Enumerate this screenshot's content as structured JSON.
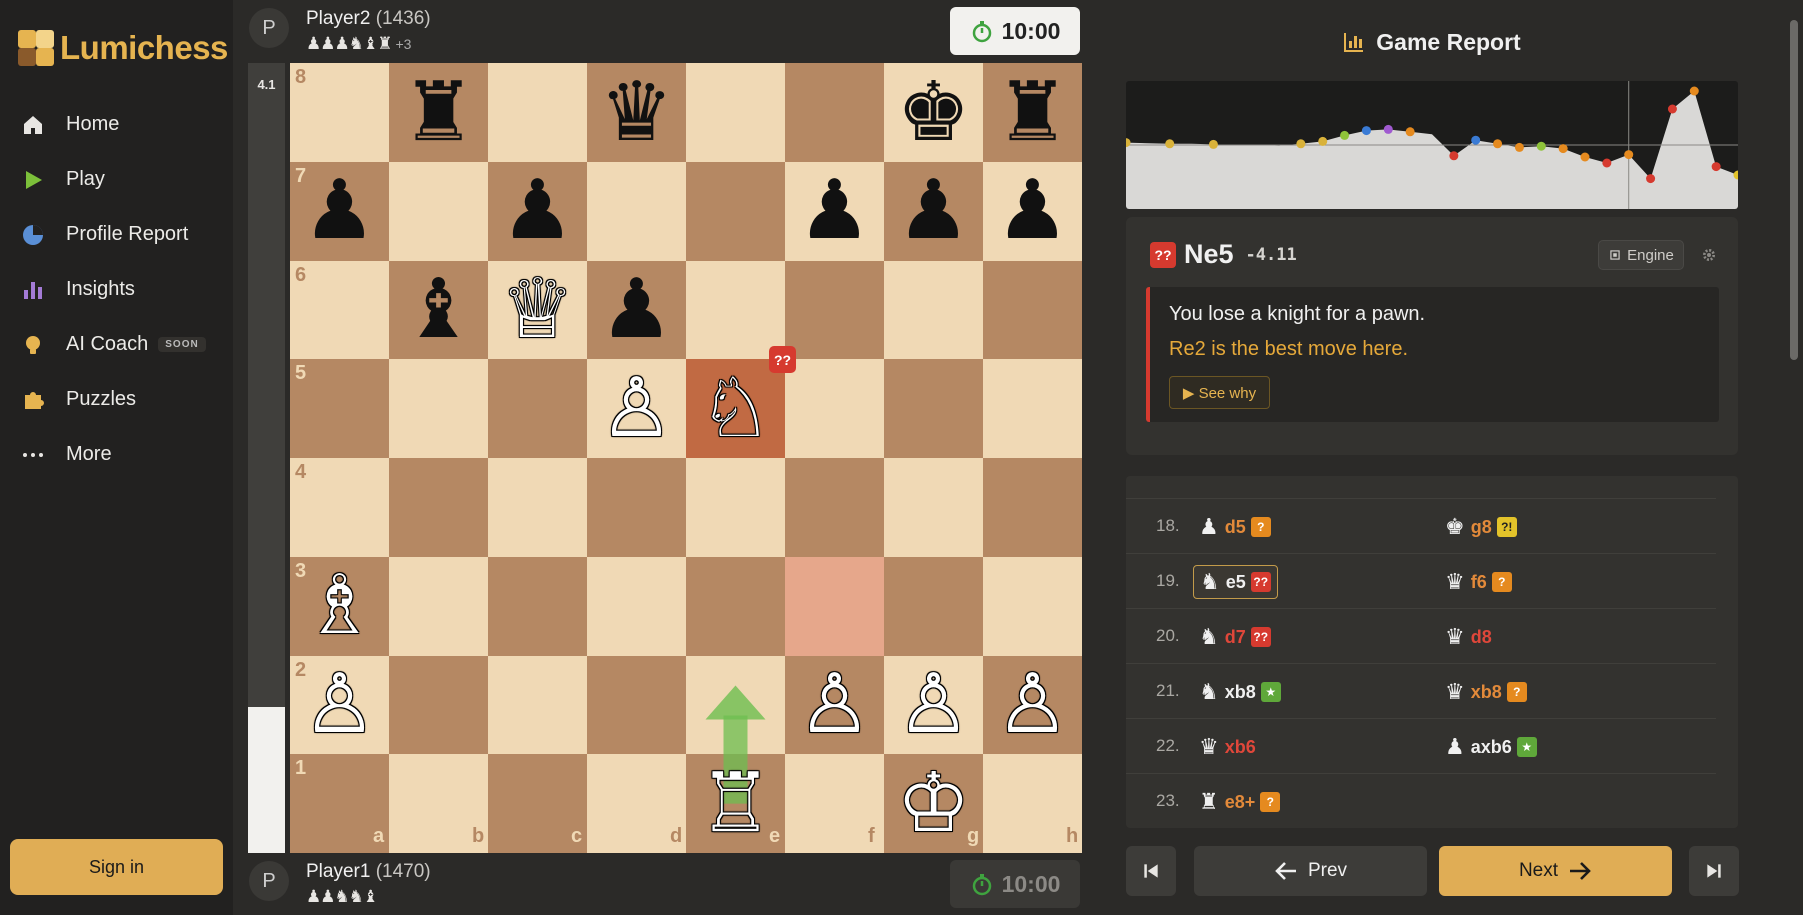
{
  "app": {
    "brand": "Lumichess"
  },
  "sidebar": {
    "items": [
      {
        "label": "Home",
        "icon": "home-icon"
      },
      {
        "label": "Play",
        "icon": "play-icon"
      },
      {
        "label": "Profile Report",
        "icon": "pie-chart-icon"
      },
      {
        "label": "Insights",
        "icon": "bar-chart-icon"
      },
      {
        "label": "AI Coach",
        "icon": "lightbulb-icon",
        "badge": "SOON"
      },
      {
        "label": "Puzzles",
        "icon": "puzzle-icon"
      },
      {
        "label": "More",
        "icon": "more-icon"
      }
    ],
    "signin": "Sign in"
  },
  "top_player": {
    "initial": "P",
    "name": "Player2",
    "rating": "(1436)",
    "captured": "♟♟♟♞♝♜",
    "captured_extra": "+3",
    "clock": "10:00"
  },
  "bottom_player": {
    "initial": "P",
    "name": "Player1",
    "rating": "(1470)",
    "captured": "♟♟♞♞♝",
    "clock": "10:00"
  },
  "eval": {
    "value": "4.1",
    "white_fraction": 0.185
  },
  "board": {
    "ranks": [
      "8",
      "7",
      "6",
      "5",
      "4",
      "3",
      "2",
      "1"
    ],
    "files": [
      "a",
      "b",
      "c",
      "d",
      "e",
      "f",
      "g",
      "h"
    ],
    "pieces": [
      {
        "sq": "b8",
        "glyph": "♜",
        "color": "b"
      },
      {
        "sq": "d8",
        "glyph": "♛",
        "color": "b"
      },
      {
        "sq": "g8",
        "glyph": "♚",
        "color": "b"
      },
      {
        "sq": "h8",
        "glyph": "♜",
        "color": "b"
      },
      {
        "sq": "a7",
        "glyph": "♟",
        "color": "b"
      },
      {
        "sq": "c7",
        "glyph": "♟",
        "color": "b"
      },
      {
        "sq": "f7",
        "glyph": "♟",
        "color": "b"
      },
      {
        "sq": "g7",
        "glyph": "♟",
        "color": "b"
      },
      {
        "sq": "h7",
        "glyph": "♟",
        "color": "b"
      },
      {
        "sq": "b6",
        "glyph": "♝",
        "color": "b"
      },
      {
        "sq": "c6",
        "glyph": "♕",
        "color": "w"
      },
      {
        "sq": "d6",
        "glyph": "♟",
        "color": "b"
      },
      {
        "sq": "d5",
        "glyph": "♙",
        "color": "w"
      },
      {
        "sq": "e5",
        "glyph": "♘",
        "color": "w"
      },
      {
        "sq": "a3",
        "glyph": "♗",
        "color": "w"
      },
      {
        "sq": "a2",
        "glyph": "♙",
        "color": "w"
      },
      {
        "sq": "f2",
        "glyph": "♙",
        "color": "w"
      },
      {
        "sq": "g2",
        "glyph": "♙",
        "color": "w"
      },
      {
        "sq": "h2",
        "glyph": "♙",
        "color": "w"
      },
      {
        "sq": "e1",
        "glyph": "♖",
        "color": "w"
      },
      {
        "sq": "g1",
        "glyph": "♔",
        "color": "w"
      }
    ],
    "highlight_to": "e5",
    "highlight_from": "f3",
    "blunder_badge": "??",
    "best_arrow": {
      "from": "e1",
      "to": "e2"
    }
  },
  "report": {
    "title": "Game Report",
    "move": {
      "badge": "??",
      "san": "Ne5",
      "eval": "-4.11",
      "engine_label": "Engine",
      "line1": "You lose a knight for a pawn.",
      "line2": "Re2 is the best move here.",
      "see_why": "▶ See why"
    },
    "moves": [
      {
        "num": "18.",
        "w": {
          "pc": "♟",
          "san": "d5",
          "tag": "?",
          "cls": "c-orange",
          "tagcls": "mistake"
        },
        "b": {
          "pc": "♚",
          "san": "g8",
          "tag": "?!",
          "cls": "c-orange",
          "tagcls": "inacc"
        }
      },
      {
        "num": "19.",
        "w": {
          "pc": "♞",
          "san": "e5",
          "tag": "??",
          "cls": "c-white",
          "tagcls": "blunder",
          "selected": true
        },
        "b": {
          "pc": "♛",
          "san": "f6",
          "tag": "?",
          "cls": "c-orange",
          "tagcls": "mistake"
        }
      },
      {
        "num": "20.",
        "w": {
          "pc": "♞",
          "san": "d7",
          "tag": "??",
          "cls": "c-red",
          "tagcls": "blunder"
        },
        "b": {
          "pc": "♛",
          "san": "d8",
          "tag": "",
          "cls": "c-red",
          "tagcls": ""
        }
      },
      {
        "num": "21.",
        "w": {
          "pc": "♞",
          "san": "xb8",
          "tag": "★",
          "cls": "c-white",
          "tagcls": "best"
        },
        "b": {
          "pc": "♛",
          "san": "xb8",
          "tag": "?",
          "cls": "c-orange",
          "tagcls": "mistake"
        }
      },
      {
        "num": "22.",
        "w": {
          "pc": "♛",
          "san": "xb6",
          "tag": "",
          "cls": "c-red",
          "tagcls": ""
        },
        "b": {
          "pc": "♟",
          "san": "axb6",
          "tag": "★",
          "cls": "c-white",
          "tagcls": "best"
        }
      },
      {
        "num": "23.",
        "w": {
          "pc": "♜",
          "san": "e8+",
          "tag": "?",
          "cls": "c-orange",
          "tagcls": "mistake"
        },
        "b": null
      }
    ],
    "prev": "Prev",
    "next": "Next"
  },
  "eval_graph": {
    "values": [
      0.2,
      0.15,
      0.1,
      0.1,
      0.05,
      0.0,
      0.0,
      -0.05,
      0.1,
      0.3,
      0.8,
      1.2,
      1.3,
      1.1,
      0.9,
      -0.9,
      0.4,
      0.1,
      -0.2,
      -0.1,
      -0.3,
      -1.0,
      -1.5,
      -0.8,
      -2.8,
      3.0,
      4.5,
      -1.8,
      -2.5
    ],
    "markers": [
      {
        "i": 0,
        "color": "#d9b23a"
      },
      {
        "i": 2,
        "color": "#d9b23a"
      },
      {
        "i": 4,
        "color": "#d9b23a"
      },
      {
        "i": 8,
        "color": "#d9b23a"
      },
      {
        "i": 9,
        "color": "#d9b23a"
      },
      {
        "i": 10,
        "color": "#8fc33a"
      },
      {
        "i": 11,
        "color": "#3a7bd5"
      },
      {
        "i": 12,
        "color": "#a05ad0"
      },
      {
        "i": 13,
        "color": "#e58a1f"
      },
      {
        "i": 15,
        "color": "#d63a2f"
      },
      {
        "i": 16,
        "color": "#3a7bd5"
      },
      {
        "i": 17,
        "color": "#e58a1f"
      },
      {
        "i": 18,
        "color": "#e58a1f"
      },
      {
        "i": 19,
        "color": "#8fc33a"
      },
      {
        "i": 20,
        "color": "#e58a1f"
      },
      {
        "i": 21,
        "color": "#e58a1f"
      },
      {
        "i": 22,
        "color": "#d63a2f"
      },
      {
        "i": 23,
        "color": "#e58a1f"
      },
      {
        "i": 24,
        "color": "#d63a2f"
      },
      {
        "i": 25,
        "color": "#d63a2f"
      },
      {
        "i": 26,
        "color": "#e58a1f"
      },
      {
        "i": 27,
        "color": "#d63a2f"
      },
      {
        "i": 28,
        "color": "#e3c32a"
      }
    ],
    "cursor_index": 23
  },
  "colors": {
    "accent": "#e0ad55",
    "blunder": "#d63a2f",
    "mistake": "#e58a1f",
    "best": "#5fa83a",
    "light_sq": "#f0d9b5",
    "dark_sq": "#b58863"
  }
}
